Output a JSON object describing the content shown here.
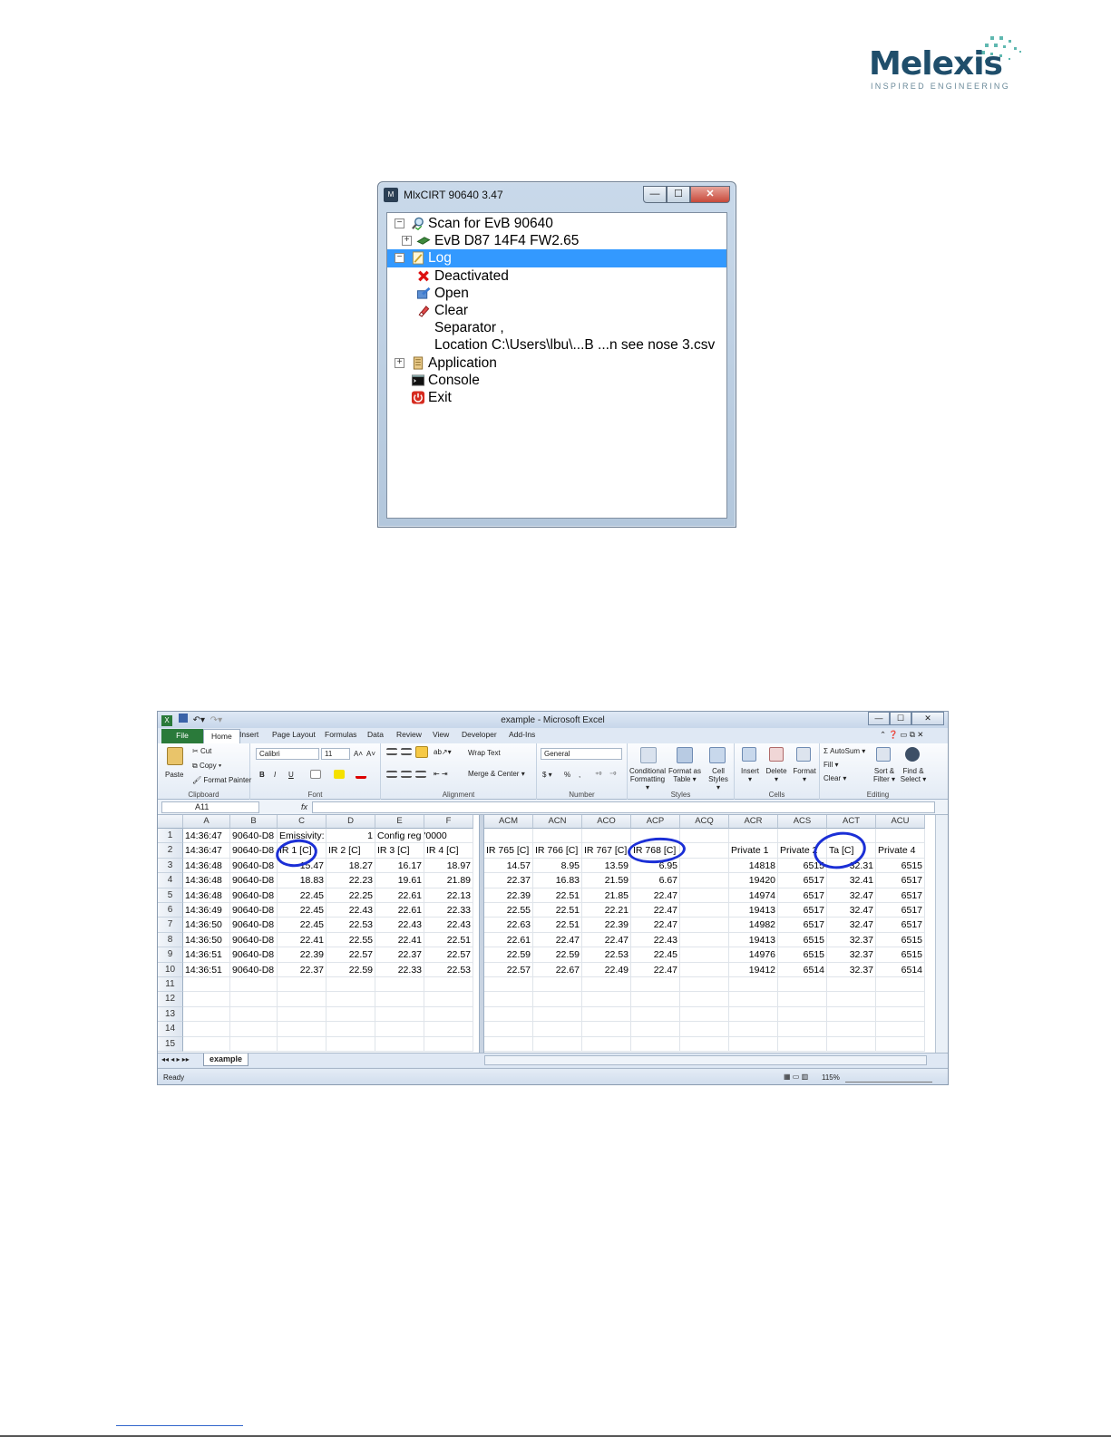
{
  "logo": {
    "word": "Melexis",
    "tagline": "INSPIRED ENGINEERING"
  },
  "mlx_window": {
    "title": "MlxCIRT 90640 3.47",
    "app_icon": "M",
    "tree": [
      {
        "label": "Scan for EvB 90640",
        "expander": "−",
        "icon": "search-icon"
      },
      {
        "label": "EvB D87 14F4 FW2.65",
        "expander": "+",
        "icon": "board-icon"
      },
      {
        "label": "Log",
        "expander": "−",
        "icon": "log-icon",
        "selected": true
      },
      {
        "label": "Deactivated",
        "icon": "red-x-icon"
      },
      {
        "label": "Open",
        "icon": "open-icon"
      },
      {
        "label": "Clear",
        "icon": "eraser-icon"
      },
      {
        "label": "Separator ,"
      },
      {
        "label": "Location C:\\Users\\lbu\\...B ...n see nose 3.csv"
      },
      {
        "label": "Application",
        "expander": "+",
        "icon": "application-icon"
      },
      {
        "label": "Console",
        "icon": "console-icon"
      },
      {
        "label": "Exit",
        "icon": "power-icon"
      }
    ],
    "buttons": {
      "minimize": "—",
      "maximize": "☐",
      "close": "✕"
    }
  },
  "excel": {
    "title": "example - Microsoft Excel",
    "tabs": [
      "File",
      "Home",
      "Insert",
      "Page Layout",
      "Formulas",
      "Data",
      "Review",
      "View",
      "Developer",
      "Add-Ins"
    ],
    "ribbon": {
      "clipboard": {
        "paste": "Paste",
        "cut": "Cut",
        "copy": "Copy ▾",
        "format_painter": "Format Painter",
        "label": "Clipboard"
      },
      "font": {
        "name": "Calibri",
        "size": "11",
        "bold": "B",
        "italic": "I",
        "underline": "U",
        "grow": "A˄",
        "shrink": "A˅",
        "label": "Font"
      },
      "alignment": {
        "wrap": "Wrap Text",
        "merge": "Merge & Center ▾",
        "label": "Alignment"
      },
      "number": {
        "format": "General",
        "currency": "$ ▾",
        "percent": "%",
        "comma": ",",
        "inc": "⁺⁰",
        "dec": "⁻⁰",
        "label": "Number"
      },
      "styles": {
        "conditional": "Conditional Formatting ▾",
        "format_table": "Format as Table ▾",
        "cell_styles": "Cell Styles ▾",
        "label": "Styles"
      },
      "cells": {
        "insert": "Insert ▾",
        "delete": "Delete ▾",
        "format": "Format ▾",
        "label": "Cells"
      },
      "editing": {
        "autosum": "Σ AutoSum ▾",
        "fill": "Fill ▾",
        "clear": "Clear ▾",
        "sort": "Sort & Filter ▾",
        "find": "Find & Select ▾",
        "label": "Editing"
      }
    },
    "name_box": "A11",
    "fx": "fx",
    "left_columns": [
      "A",
      "B",
      "C",
      "D",
      "E",
      "F"
    ],
    "right_columns": [
      "ACM",
      "ACN",
      "ACO",
      "ACP",
      "ACQ",
      "ACR",
      "ACS",
      "ACT",
      "ACU"
    ],
    "row_numbers": [
      "1",
      "2",
      "3",
      "4",
      "5",
      "6",
      "7",
      "8",
      "9",
      "10",
      "11",
      "12",
      "13",
      "14",
      "15"
    ],
    "rows": [
      {
        "A": "14:36:47",
        "B": "90640-D8",
        "C": "Emissivity:",
        "D": "1",
        "E": "Config reg '0000",
        "F": "",
        "ACM": "",
        "ACN": "",
        "ACO": "",
        "ACP": "",
        "ACQ": "",
        "ACR": "",
        "ACS": "",
        "ACT": "",
        "ACU": ""
      },
      {
        "A": "14:36:47",
        "B": "90640-D8",
        "C": "IR 1 [C]",
        "D": "IR 2 [C]",
        "E": "IR 3 [C]",
        "F": "IR 4 [C]",
        "ACM": "IR 765 [C]",
        "ACN": "IR 766 [C]",
        "ACO": "IR 767 [C]",
        "ACP": "IR 768 [C]",
        "ACQ": "",
        "ACR": "Private 1",
        "ACS": "Private 2",
        "ACT": "Ta [C]",
        "ACU": "Private 4"
      },
      {
        "A": "14:36:48",
        "B": "90640-D8",
        "C": "15.47",
        "D": "18.27",
        "E": "16.17",
        "F": "18.97",
        "ACM": "14.57",
        "ACN": "8.95",
        "ACO": "13.59",
        "ACP": "6.95",
        "ACQ": "",
        "ACR": "14818",
        "ACS": "6515",
        "ACT": "32.31",
        "ACU": "6515"
      },
      {
        "A": "14:36:48",
        "B": "90640-D8",
        "C": "18.83",
        "D": "22.23",
        "E": "19.61",
        "F": "21.89",
        "ACM": "22.37",
        "ACN": "16.83",
        "ACO": "21.59",
        "ACP": "6.67",
        "ACQ": "",
        "ACR": "19420",
        "ACS": "6517",
        "ACT": "32.41",
        "ACU": "6517"
      },
      {
        "A": "14:36:48",
        "B": "90640-D8",
        "C": "22.45",
        "D": "22.25",
        "E": "22.61",
        "F": "22.13",
        "ACM": "22.39",
        "ACN": "22.51",
        "ACO": "21.85",
        "ACP": "22.47",
        "ACQ": "",
        "ACR": "14974",
        "ACS": "6517",
        "ACT": "32.47",
        "ACU": "6517"
      },
      {
        "A": "14:36:49",
        "B": "90640-D8",
        "C": "22.45",
        "D": "22.43",
        "E": "22.61",
        "F": "22.33",
        "ACM": "22.55",
        "ACN": "22.51",
        "ACO": "22.21",
        "ACP": "22.47",
        "ACQ": "",
        "ACR": "19413",
        "ACS": "6517",
        "ACT": "32.47",
        "ACU": "6517"
      },
      {
        "A": "14:36:50",
        "B": "90640-D8",
        "C": "22.45",
        "D": "22.53",
        "E": "22.43",
        "F": "22.43",
        "ACM": "22.63",
        "ACN": "22.51",
        "ACO": "22.39",
        "ACP": "22.47",
        "ACQ": "",
        "ACR": "14982",
        "ACS": "6517",
        "ACT": "32.47",
        "ACU": "6517"
      },
      {
        "A": "14:36:50",
        "B": "90640-D8",
        "C": "22.41",
        "D": "22.55",
        "E": "22.41",
        "F": "22.51",
        "ACM": "22.61",
        "ACN": "22.47",
        "ACO": "22.47",
        "ACP": "22.43",
        "ACQ": "",
        "ACR": "19413",
        "ACS": "6515",
        "ACT": "32.37",
        "ACU": "6515"
      },
      {
        "A": "14:36:51",
        "B": "90640-D8",
        "C": "22.39",
        "D": "22.57",
        "E": "22.37",
        "F": "22.57",
        "ACM": "22.59",
        "ACN": "22.59",
        "ACO": "22.53",
        "ACP": "22.45",
        "ACQ": "",
        "ACR": "14976",
        "ACS": "6515",
        "ACT": "32.37",
        "ACU": "6515"
      },
      {
        "A": "14:36:51",
        "B": "90640-D8",
        "C": "22.37",
        "D": "22.59",
        "E": "22.33",
        "F": "22.53",
        "ACM": "22.57",
        "ACN": "22.67",
        "ACO": "22.49",
        "ACP": "22.47",
        "ACQ": "",
        "ACR": "19412",
        "ACS": "6514",
        "ACT": "32.37",
        "ACU": "6514"
      }
    ],
    "sheet_tab": "example",
    "status": {
      "ready": "Ready",
      "zoom": "115%"
    }
  },
  "colors": {
    "selection": "#3399ff",
    "excel_green": "#2a7a3a",
    "annotation_circle": "#1b2fd6",
    "logo_blue": "#1f4e6b"
  }
}
